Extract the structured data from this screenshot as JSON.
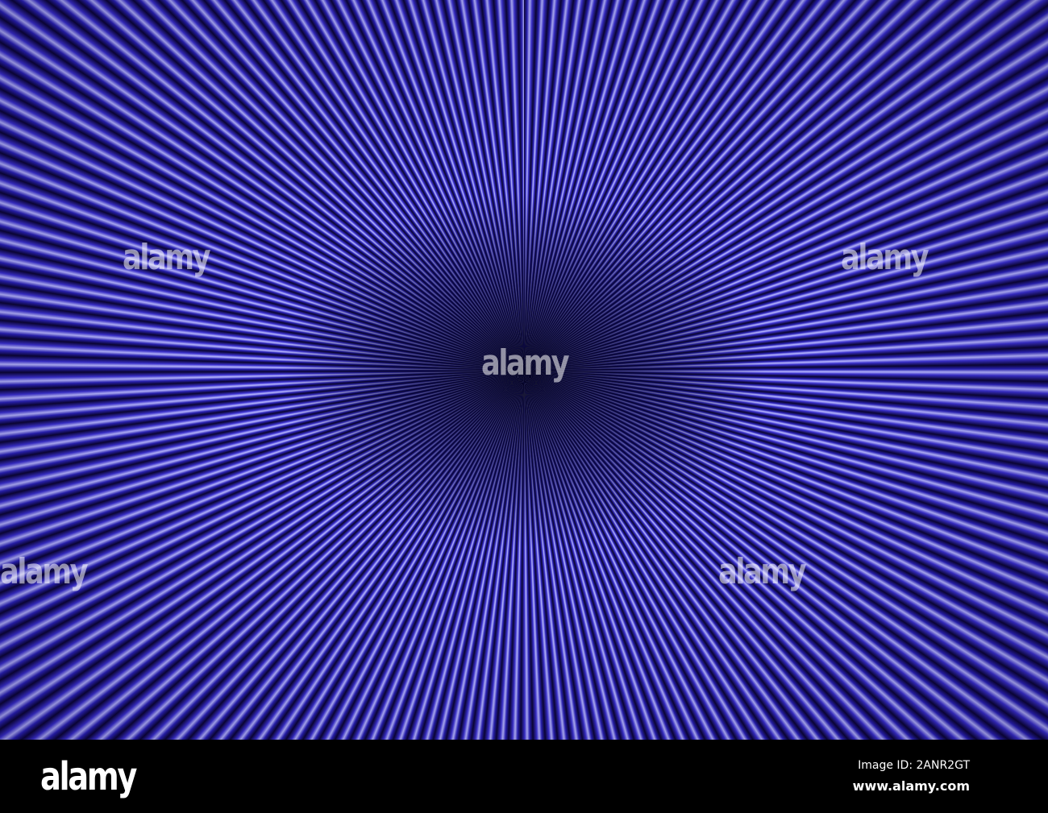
{
  "watermark": {
    "text": "alamy"
  },
  "footer": {
    "logo": "alamy",
    "image_id": "Image ID: 2ANR2GT",
    "url": "www.alamy.com"
  }
}
